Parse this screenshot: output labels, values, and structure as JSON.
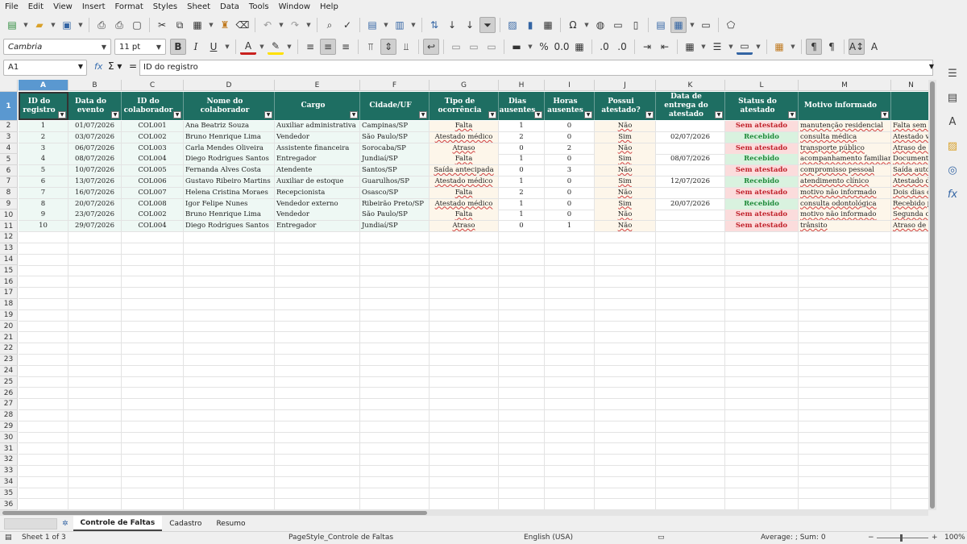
{
  "menu": [
    "File",
    "Edit",
    "View",
    "Insert",
    "Format",
    "Styles",
    "Sheet",
    "Data",
    "Tools",
    "Window",
    "Help"
  ],
  "toolbar": {
    "font_name": "Cambria",
    "font_size": "11 pt",
    "bold": "B",
    "italic": "I",
    "underline": "U",
    "percent": "%",
    "decimal": "0.0"
  },
  "formula_bar": {
    "cell_ref": "A1",
    "content": "ID do registro"
  },
  "columns": [
    "A",
    "B",
    "C",
    "D",
    "E",
    "F",
    "G",
    "H",
    "I",
    "J",
    "K",
    "L",
    "M",
    "N"
  ],
  "headers": [
    "ID do registro",
    "Data do evento",
    "ID do colaborador",
    "Nome do colaborador",
    "Cargo",
    "Cidade/UF",
    "Tipo de ocorrência",
    "Dias ausentes",
    "Horas ausentes",
    "Possui atestado?",
    "Data de entrega do atestado",
    "Status do atestado",
    "Motivo informado",
    ""
  ],
  "rows": [
    [
      "1",
      "01/07/2026",
      "COL001",
      "Ana Beatriz Souza",
      "Auxiliar administrativa",
      "Campinas/SP",
      "Falta",
      "1",
      "0",
      "Não",
      "",
      "Sem atestado",
      "manutenção residencial",
      "Falta sem do"
    ],
    [
      "2",
      "03/07/2026",
      "COL002",
      "Bruno Henrique Lima",
      "Vendedor",
      "São Paulo/SP",
      "Atestado médico",
      "2",
      "0",
      "Sim",
      "02/07/2026",
      "Recebido",
      "consulta médica",
      "Atestado vál"
    ],
    [
      "3",
      "06/07/2026",
      "COL003",
      "Carla Mendes Oliveira",
      "Assistente financeira",
      "Sorocaba/SP",
      "Atraso",
      "0",
      "2",
      "Não",
      "",
      "Sem atestado",
      "transporte público",
      "Atraso de 2h"
    ],
    [
      "4",
      "08/07/2026",
      "COL004",
      "Diego Rodrigues Santos",
      "Entregador",
      "Jundiaí/SP",
      "Falta",
      "1",
      "0",
      "Sim",
      "08/07/2026",
      "Recebido",
      "acompanhamento familiar",
      "Documento e"
    ],
    [
      "5",
      "10/07/2026",
      "COL005",
      "Fernanda Alves Costa",
      "Atendente",
      "Santos/SP",
      "Saída antecipada",
      "0",
      "3",
      "Não",
      "",
      "Sem atestado",
      "compromisso pessoal",
      "Saída autori"
    ],
    [
      "6",
      "13/07/2026",
      "COL006",
      "Gustavo Ribeiro Martins",
      "Auxiliar de estoque",
      "Guarulhos/SP",
      "Atestado médico",
      "1",
      "0",
      "Sim",
      "12/07/2026",
      "Recebido",
      "atendimento clínico",
      "Atestado de"
    ],
    [
      "7",
      "16/07/2026",
      "COL007",
      "Helena Cristina Moraes",
      "Recepcionista",
      "Osasco/SP",
      "Falta",
      "2",
      "0",
      "Não",
      "",
      "Sem atestado",
      "motivo não informado",
      "Dois dias co"
    ],
    [
      "8",
      "20/07/2026",
      "COL008",
      "Igor Felipe Nunes",
      "Vendedor externo",
      "Ribeirão Preto/SP",
      "Atestado médico",
      "1",
      "0",
      "Sim",
      "20/07/2026",
      "Recebido",
      "consulta odontológica",
      "Recebido po"
    ],
    [
      "9",
      "23/07/2026",
      "COL002",
      "Bruno Henrique Lima",
      "Vendedor",
      "São Paulo/SP",
      "Falta",
      "1",
      "0",
      "Não",
      "",
      "Sem atestado",
      "motivo não informado",
      "Segunda oco"
    ],
    [
      "10",
      "29/07/2026",
      "COL004",
      "Diego Rodrigues Santos",
      "Entregador",
      "Jundiaí/SP",
      "Atraso",
      "0",
      "1",
      "Não",
      "",
      "Sem atestado",
      "trânsito",
      "Atraso de 1h"
    ]
  ],
  "row_numbers": [
    "1",
    "2",
    "3",
    "4",
    "5",
    "6",
    "7",
    "8",
    "9",
    "10",
    "11",
    "12",
    "13",
    "14",
    "15",
    "16",
    "17",
    "18",
    "19",
    "20",
    "21",
    "22",
    "23",
    "24",
    "25",
    "26",
    "27",
    "28",
    "29",
    "30",
    "31",
    "32",
    "33",
    "34",
    "35",
    "36"
  ],
  "sheet_tabs": [
    "Controle de Faltas",
    "Cadastro",
    "Resumo"
  ],
  "status_bar": {
    "sheet": "Sheet 1 of 3",
    "page_style": "PageStyle_Controle de Faltas",
    "language": "English (USA)",
    "sum": "Average: ; Sum: 0",
    "zoom": "100%"
  },
  "colors": {
    "header_bg": "#1e6e62",
    "selected": "#5a98d0",
    "no_cert": "#c0202a",
    "received": "#1f8a3a"
  }
}
